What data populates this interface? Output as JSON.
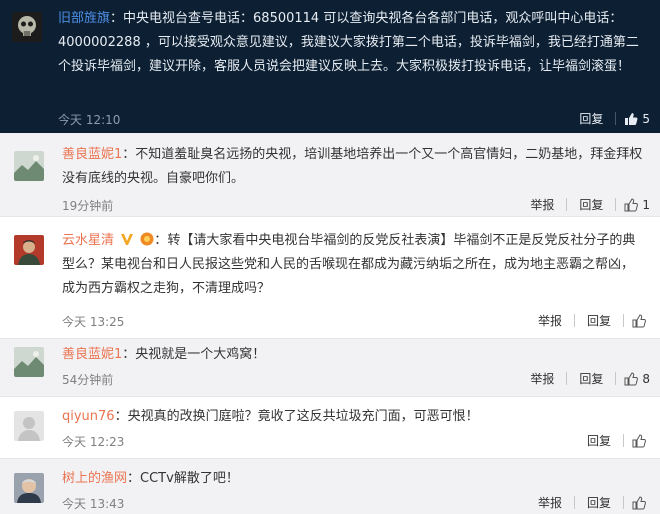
{
  "featured": {
    "user": "旧部旌旗",
    "text": "中央电视台查号电话：68500114 可以查询央视各台各部门电话，观众呼叫中心电话：4000002288 ，可以接受观众意见建议，我建议大家拨打第二个电话，投诉毕福剑，我已经打通第二个投诉毕福剑，建议开除，客服人员说会把建议反映上去。大家积极拨打投诉电话，让毕福剑滚蛋！",
    "time": "今天 12:10",
    "reply_label": "回复",
    "like_count": "5",
    "colors": {
      "bg": "#0d1f33",
      "user": "#4d8fe6",
      "text": "#e6ecf2"
    }
  },
  "comments": [
    {
      "user": "善良蓝妮1",
      "text": "不知道羞耻臭名远扬的央视，培训基地培养出一个又一个高官情妇，二奶基地，拜金拜权没有底线的央视。自豪吧你们。",
      "time": "19分钟前",
      "report_label": "举报",
      "reply_label": "回复",
      "like_count": "1",
      "avatar_icon": "landscape-avatar-icon"
    },
    {
      "user": "云水星清",
      "text": "转【请大家看中央电视台毕福剑的反党反社表演】毕福剑不正是反党反社分子的典型么？某电视台和日人民报这些党和人民的舌喉现在都成为藏污纳垢之所在，成为地主恶霸之帮凶，成为西方霸权之走狗，不清理成吗？",
      "time": "今天 13:25",
      "report_label": "举报",
      "reply_label": "回复",
      "like_count": "",
      "avatar_icon": "portrait-avatar-icon",
      "badges": [
        "verified-v-icon",
        "vip-badge-icon"
      ]
    },
    {
      "user": "善良蓝妮1",
      "text": "央视就是一个大鸡窝！",
      "time": "54分钟前",
      "report_label": "举报",
      "reply_label": "回复",
      "like_count": "8",
      "avatar_icon": "landscape-avatar-icon"
    },
    {
      "user": "qiyun76",
      "text": "央视真的改换门庭啦？竟收了这反共垃圾充门面，可恶可恨！",
      "time": "今天 12:23",
      "reply_label": "回复",
      "like_count": "",
      "avatar_icon": "default-avatar-icon"
    },
    {
      "user": "树上的渔网",
      "text": "CCTv解散了吧！",
      "time": "今天 13:43",
      "report_label": "举报",
      "reply_label": "回复",
      "like_count": "",
      "avatar_icon": "face-avatar-icon"
    }
  ],
  "colors": {
    "username": "#eb7350",
    "text": "#333333",
    "time": "#808080",
    "alt_bg": "#f2f2f5"
  }
}
